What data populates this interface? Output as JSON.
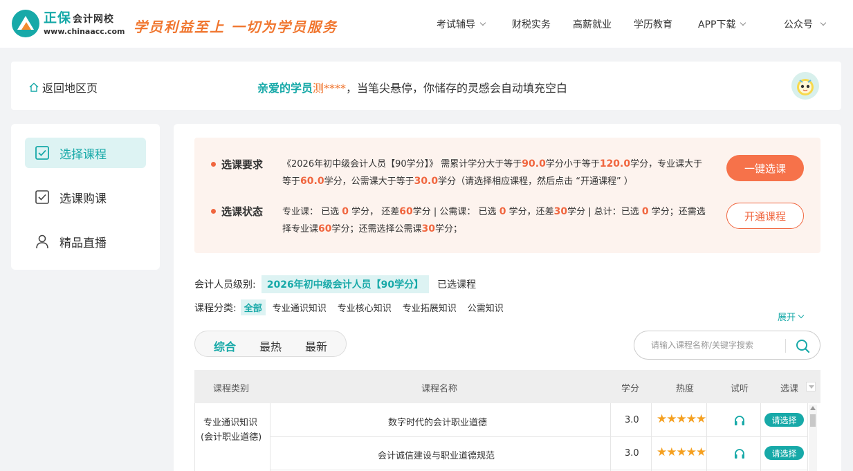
{
  "header": {
    "brand_name": "正保",
    "brand_sub": "会计网校",
    "brand_url": "www.chinaacc.com",
    "slogan": "学员利益至上 一切为学员服务",
    "nav": [
      {
        "label": "考试辅导",
        "has_dropdown": true
      },
      {
        "label": "财税实务",
        "has_dropdown": false
      },
      {
        "label": "高薪就业",
        "has_dropdown": false
      },
      {
        "label": "学历教育",
        "has_dropdown": false
      },
      {
        "label": "APP下载",
        "has_dropdown": true
      },
      {
        "label": "公众号",
        "has_dropdown": true
      }
    ]
  },
  "greeting": {
    "back_label": "返回地区页",
    "prefix": "亲爱的学员",
    "user_name": "测****",
    "message": "，当笔尖悬停，你储存的灵感会自动填充空白"
  },
  "sidebar": {
    "items": [
      {
        "label": "选择课程",
        "icon": "checkbox-icon",
        "active": true
      },
      {
        "label": "选课购课",
        "icon": "checkbox-icon",
        "active": false
      },
      {
        "label": "精品直播",
        "icon": "user-icon",
        "active": false
      }
    ]
  },
  "requirements": {
    "req_title": "选课要求",
    "req_parts": [
      "《2026年初中级会计人员【90学分】》 需累计学分大于等于",
      "90.0",
      "学分小于等于",
      "120.0",
      "学分，专业课大于等于",
      "60.0",
      "学分，公需课大于等于",
      "30.0",
      "学分（请选择相应课程，然后点击 “开通课程” ）"
    ],
    "status_title": "选课状态",
    "status_parts": [
      "专业课： 已选 ",
      "0",
      " 学分， 还差",
      "60",
      "学分 | 公需课： 已选 ",
      "0",
      " 学分，还差",
      "30",
      "学分 | 总计：已选 ",
      "0",
      " 学分；还需选择专业课",
      "60",
      "学分；还需选择公需课",
      "30",
      "学分；"
    ],
    "one_click_label": "一键选课",
    "open_label": "开通课程"
  },
  "filters": {
    "level_label": "会计人员级别:",
    "level_value": "2026年初中级会计人员【90学分】",
    "selected_label": "已选课程",
    "category_label": "课程分类:",
    "categories": [
      "全部",
      "专业通识知识",
      "专业核心知识",
      "专业拓展知识",
      "公需知识"
    ],
    "expand_label": "展开"
  },
  "sort": {
    "options": [
      "综合",
      "最热",
      "最新"
    ],
    "active": 0
  },
  "search": {
    "placeholder": "请输入课程名称/关键字搜索"
  },
  "table": {
    "headers": [
      "课程类别",
      "课程名称",
      "学分",
      "热度",
      "试听",
      "选课"
    ],
    "category_cell": [
      "专业通识知识",
      "(会计职业道德)"
    ],
    "rows": [
      {
        "name": "数字时代的会计职业道德",
        "credit": "3.0",
        "stars": 5,
        "pick_label": "请选择"
      },
      {
        "name": "会计诚信建设与职业道德规范",
        "credit": "3.0",
        "stars": 5,
        "pick_label": "请选择"
      }
    ]
  },
  "colors": {
    "accent": "#17a9a8",
    "orange": "#f0663f",
    "star": "#f5a020"
  }
}
